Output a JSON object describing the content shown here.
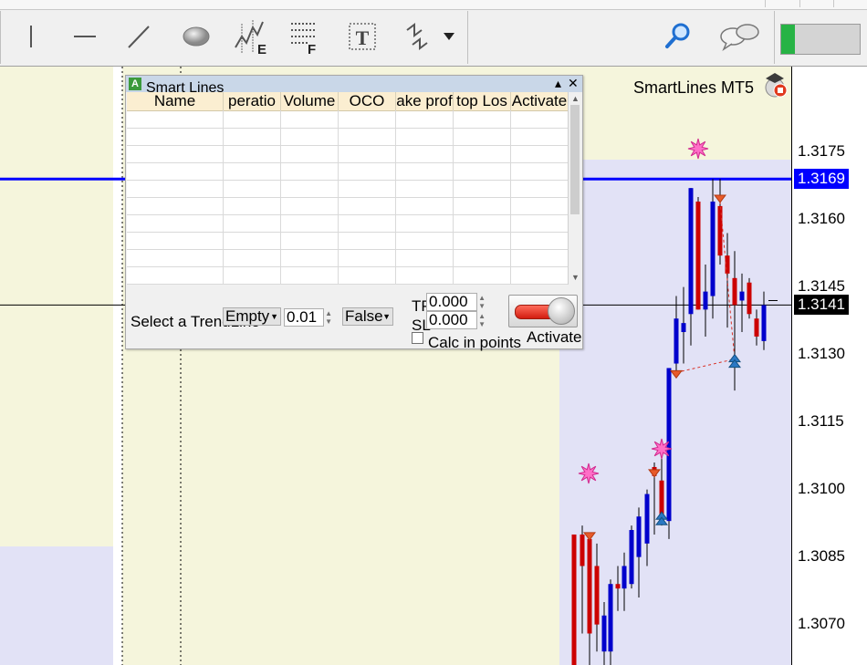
{
  "brand": {
    "label": "SmartLines MT5"
  },
  "toolbar": {
    "tools": [
      {
        "name": "vertical-line-icon"
      },
      {
        "name": "horizontal-line-icon"
      },
      {
        "name": "trendline-icon"
      },
      {
        "name": "ellipse-icon"
      },
      {
        "name": "elliott-wave-icon",
        "label": "E"
      },
      {
        "name": "fibonacci-icon",
        "label": "F"
      },
      {
        "name": "text-label-icon",
        "label": "T"
      },
      {
        "name": "shapes-dropdown-icon"
      }
    ],
    "right": [
      {
        "name": "search-icon"
      },
      {
        "name": "chat-icon"
      }
    ],
    "connection_meter": {
      "fraction": 0.18,
      "fill_color": "#27b345"
    }
  },
  "chart": {
    "price_min": 1.3061,
    "price_max": 1.3194,
    "price_ticks": [
      "1.3175",
      "1.3160",
      "1.3145",
      "1.3130",
      "1.3115",
      "1.3100",
      "1.3085",
      "1.3070"
    ],
    "blue_line_price": "1.3169",
    "current_price": "1.3141",
    "colors": {
      "bull": "#0000cc",
      "bear": "#cc0000",
      "blue_line": "#0000ff",
      "highlight": "#e2e2f6"
    }
  },
  "panel": {
    "title": "Smart Lines",
    "icon_letter": "A",
    "controls": {
      "minimize": "▴",
      "close": "✕"
    },
    "columns": [
      "Name",
      "peratio",
      "Volume",
      "OCO",
      "ake prof",
      "top Los",
      "Activate"
    ],
    "row_count": 10,
    "select_label": "Select a TrendLine",
    "operation_value": "Empty",
    "volume_value": "0.01",
    "oco_value": "False",
    "tp_label": "TP",
    "sl_label": "SL",
    "tp_value": "0.000",
    "sl_value": "0.000",
    "calc_label": "Calc in points",
    "activate_label": "Activate"
  }
}
